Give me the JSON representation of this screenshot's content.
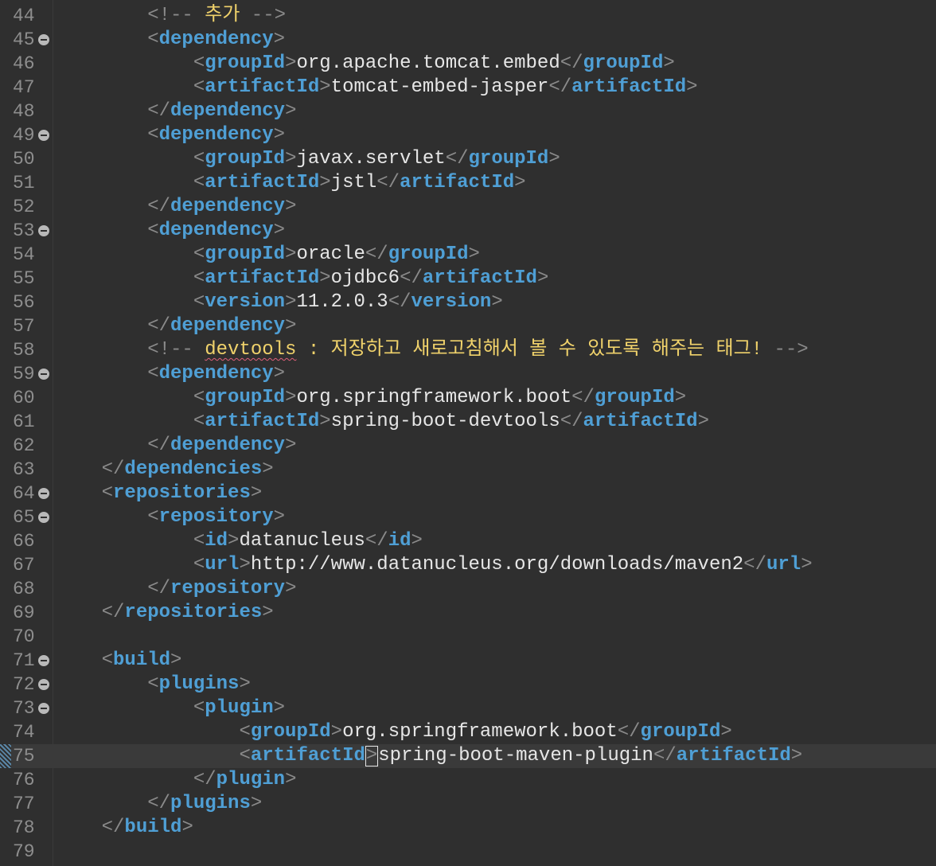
{
  "editor": {
    "current_line": "75",
    "lines": [
      {
        "num": "44",
        "fold": false,
        "indent": "        ",
        "segments": [
          [
            "c",
            "<!-- "
          ],
          [
            "k",
            "추가"
          ],
          [
            "c",
            " -->"
          ]
        ]
      },
      {
        "num": "45",
        "fold": true,
        "indent": "        ",
        "segments": [
          [
            "b",
            "<"
          ],
          [
            "t",
            "dependency"
          ],
          [
            "b",
            ">"
          ]
        ]
      },
      {
        "num": "46",
        "fold": false,
        "indent": "            ",
        "segments": [
          [
            "b",
            "<"
          ],
          [
            "t",
            "groupId"
          ],
          [
            "b",
            ">"
          ],
          [
            "x",
            "org.apache.tomcat.embed"
          ],
          [
            "b",
            "</"
          ],
          [
            "t",
            "groupId"
          ],
          [
            "b",
            ">"
          ]
        ]
      },
      {
        "num": "47",
        "fold": false,
        "indent": "            ",
        "segments": [
          [
            "b",
            "<"
          ],
          [
            "t",
            "artifactId"
          ],
          [
            "b",
            ">"
          ],
          [
            "x",
            "tomcat-embed-jasper"
          ],
          [
            "b",
            "</"
          ],
          [
            "t",
            "artifactId"
          ],
          [
            "b",
            ">"
          ]
        ]
      },
      {
        "num": "48",
        "fold": false,
        "indent": "        ",
        "segments": [
          [
            "b",
            "</"
          ],
          [
            "t",
            "dependency"
          ],
          [
            "b",
            ">"
          ]
        ]
      },
      {
        "num": "49",
        "fold": true,
        "indent": "        ",
        "segments": [
          [
            "b",
            "<"
          ],
          [
            "t",
            "dependency"
          ],
          [
            "b",
            ">"
          ]
        ]
      },
      {
        "num": "50",
        "fold": false,
        "indent": "            ",
        "segments": [
          [
            "b",
            "<"
          ],
          [
            "t",
            "groupId"
          ],
          [
            "b",
            ">"
          ],
          [
            "x",
            "javax.servlet"
          ],
          [
            "b",
            "</"
          ],
          [
            "t",
            "groupId"
          ],
          [
            "b",
            ">"
          ]
        ]
      },
      {
        "num": "51",
        "fold": false,
        "indent": "            ",
        "segments": [
          [
            "b",
            "<"
          ],
          [
            "t",
            "artifactId"
          ],
          [
            "b",
            ">"
          ],
          [
            "x",
            "jstl"
          ],
          [
            "b",
            "</"
          ],
          [
            "t",
            "artifactId"
          ],
          [
            "b",
            ">"
          ]
        ]
      },
      {
        "num": "52",
        "fold": false,
        "indent": "        ",
        "segments": [
          [
            "b",
            "</"
          ],
          [
            "t",
            "dependency"
          ],
          [
            "b",
            ">"
          ]
        ]
      },
      {
        "num": "53",
        "fold": true,
        "indent": "        ",
        "segments": [
          [
            "b",
            "<"
          ],
          [
            "t",
            "dependency"
          ],
          [
            "b",
            ">"
          ]
        ]
      },
      {
        "num": "54",
        "fold": false,
        "indent": "            ",
        "segments": [
          [
            "b",
            "<"
          ],
          [
            "t",
            "groupId"
          ],
          [
            "b",
            ">"
          ],
          [
            "x",
            "oracle"
          ],
          [
            "b",
            "</"
          ],
          [
            "t",
            "groupId"
          ],
          [
            "b",
            ">"
          ]
        ]
      },
      {
        "num": "55",
        "fold": false,
        "indent": "            ",
        "segments": [
          [
            "b",
            "<"
          ],
          [
            "t",
            "artifactId"
          ],
          [
            "b",
            ">"
          ],
          [
            "x",
            "ojdbc6"
          ],
          [
            "b",
            "</"
          ],
          [
            "t",
            "artifactId"
          ],
          [
            "b",
            ">"
          ]
        ]
      },
      {
        "num": "56",
        "fold": false,
        "indent": "            ",
        "segments": [
          [
            "b",
            "<"
          ],
          [
            "t",
            "version"
          ],
          [
            "b",
            ">"
          ],
          [
            "x",
            "11.2.0.3"
          ],
          [
            "b",
            "</"
          ],
          [
            "t",
            "version"
          ],
          [
            "b",
            ">"
          ]
        ]
      },
      {
        "num": "57",
        "fold": false,
        "indent": "        ",
        "segments": [
          [
            "b",
            "</"
          ],
          [
            "t",
            "dependency"
          ],
          [
            "b",
            ">"
          ]
        ]
      },
      {
        "num": "58",
        "fold": false,
        "indent": "        ",
        "segments": [
          [
            "c",
            "<!-- "
          ],
          [
            "ks",
            "devtools"
          ],
          [
            "k",
            " : 저장하고 새로고침해서 볼 수 있도록 해주는 태그! "
          ],
          [
            "c",
            "-->"
          ]
        ]
      },
      {
        "num": "59",
        "fold": true,
        "indent": "        ",
        "segments": [
          [
            "b",
            "<"
          ],
          [
            "t",
            "dependency"
          ],
          [
            "b",
            ">"
          ]
        ]
      },
      {
        "num": "60",
        "fold": false,
        "indent": "            ",
        "segments": [
          [
            "b",
            "<"
          ],
          [
            "t",
            "groupId"
          ],
          [
            "b",
            ">"
          ],
          [
            "x",
            "org.springframework.boot"
          ],
          [
            "b",
            "</"
          ],
          [
            "t",
            "groupId"
          ],
          [
            "b",
            ">"
          ]
        ]
      },
      {
        "num": "61",
        "fold": false,
        "indent": "            ",
        "segments": [
          [
            "b",
            "<"
          ],
          [
            "t",
            "artifactId"
          ],
          [
            "b",
            ">"
          ],
          [
            "x",
            "spring-boot-devtools"
          ],
          [
            "b",
            "</"
          ],
          [
            "t",
            "artifactId"
          ],
          [
            "b",
            ">"
          ]
        ]
      },
      {
        "num": "62",
        "fold": false,
        "indent": "        ",
        "segments": [
          [
            "b",
            "</"
          ],
          [
            "t",
            "dependency"
          ],
          [
            "b",
            ">"
          ]
        ]
      },
      {
        "num": "63",
        "fold": false,
        "indent": "    ",
        "segments": [
          [
            "b",
            "</"
          ],
          [
            "t",
            "dependencies"
          ],
          [
            "b",
            ">"
          ]
        ]
      },
      {
        "num": "64",
        "fold": true,
        "indent": "    ",
        "segments": [
          [
            "b",
            "<"
          ],
          [
            "t",
            "repositories"
          ],
          [
            "b",
            ">"
          ]
        ]
      },
      {
        "num": "65",
        "fold": true,
        "indent": "        ",
        "segments": [
          [
            "b",
            "<"
          ],
          [
            "t",
            "repository"
          ],
          [
            "b",
            ">"
          ]
        ]
      },
      {
        "num": "66",
        "fold": false,
        "indent": "            ",
        "segments": [
          [
            "b",
            "<"
          ],
          [
            "t",
            "id"
          ],
          [
            "b",
            ">"
          ],
          [
            "x",
            "datanucleus"
          ],
          [
            "b",
            "</"
          ],
          [
            "t",
            "id"
          ],
          [
            "b",
            ">"
          ]
        ]
      },
      {
        "num": "67",
        "fold": false,
        "indent": "            ",
        "segments": [
          [
            "b",
            "<"
          ],
          [
            "t",
            "url"
          ],
          [
            "b",
            ">"
          ],
          [
            "x",
            "http://www.datanucleus.org/downloads/maven2"
          ],
          [
            "b",
            "</"
          ],
          [
            "t",
            "url"
          ],
          [
            "b",
            ">"
          ]
        ]
      },
      {
        "num": "68",
        "fold": false,
        "indent": "        ",
        "segments": [
          [
            "b",
            "</"
          ],
          [
            "t",
            "repository"
          ],
          [
            "b",
            ">"
          ]
        ]
      },
      {
        "num": "69",
        "fold": false,
        "indent": "    ",
        "segments": [
          [
            "b",
            "</"
          ],
          [
            "t",
            "repositories"
          ],
          [
            "b",
            ">"
          ]
        ]
      },
      {
        "num": "70",
        "fold": false,
        "indent": "",
        "segments": []
      },
      {
        "num": "71",
        "fold": true,
        "indent": "    ",
        "segments": [
          [
            "b",
            "<"
          ],
          [
            "t",
            "build"
          ],
          [
            "b",
            ">"
          ]
        ]
      },
      {
        "num": "72",
        "fold": true,
        "indent": "        ",
        "segments": [
          [
            "b",
            "<"
          ],
          [
            "t",
            "plugins"
          ],
          [
            "b",
            ">"
          ]
        ]
      },
      {
        "num": "73",
        "fold": true,
        "indent": "            ",
        "segments": [
          [
            "b",
            "<"
          ],
          [
            "t",
            "plugin"
          ],
          [
            "b",
            ">"
          ]
        ]
      },
      {
        "num": "74",
        "fold": false,
        "indent": "                ",
        "segments": [
          [
            "b",
            "<"
          ],
          [
            "t",
            "groupId"
          ],
          [
            "b",
            ">"
          ],
          [
            "x",
            "org.springframework.boot"
          ],
          [
            "b",
            "</"
          ],
          [
            "t",
            "groupId"
          ],
          [
            "b",
            ">"
          ]
        ]
      },
      {
        "num": "75",
        "fold": false,
        "indent": "                ",
        "segments": [
          [
            "b",
            "<"
          ],
          [
            "t",
            "artifactId"
          ],
          [
            "cb",
            ">"
          ],
          [
            "x",
            "spring-boot-maven-plugin"
          ],
          [
            "b",
            "</"
          ],
          [
            "t",
            "artifactId"
          ],
          [
            "b",
            ">"
          ]
        ]
      },
      {
        "num": "76",
        "fold": false,
        "indent": "            ",
        "segments": [
          [
            "b",
            "</"
          ],
          [
            "t",
            "plugin"
          ],
          [
            "b",
            ">"
          ]
        ]
      },
      {
        "num": "77",
        "fold": false,
        "indent": "        ",
        "segments": [
          [
            "b",
            "</"
          ],
          [
            "t",
            "plugins"
          ],
          [
            "b",
            ">"
          ]
        ]
      },
      {
        "num": "78",
        "fold": false,
        "indent": "    ",
        "segments": [
          [
            "b",
            "</"
          ],
          [
            "t",
            "build"
          ],
          [
            "b",
            ">"
          ]
        ]
      },
      {
        "num": "79",
        "fold": false,
        "indent": "",
        "segments": []
      }
    ]
  }
}
